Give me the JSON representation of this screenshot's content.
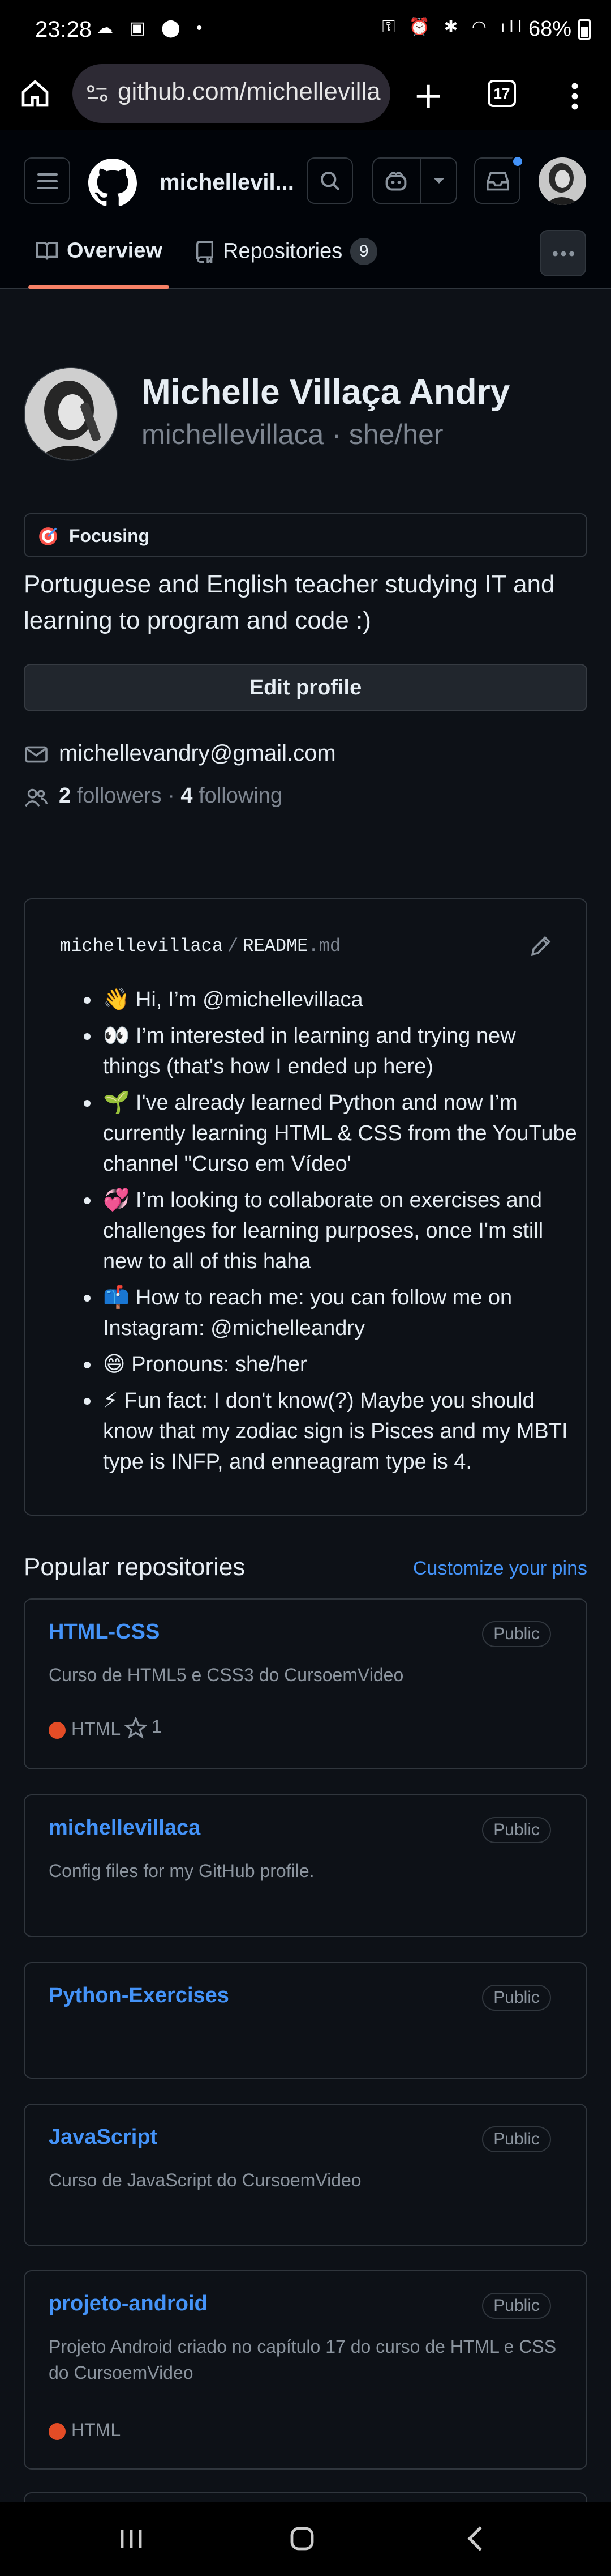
{
  "status_bar": {
    "time": "23:28",
    "battery": "68%"
  },
  "browser": {
    "url": "github.com/michellevilla",
    "tab_count": "17"
  },
  "header": {
    "username": "michellevil...",
    "tabs": [
      {
        "label": "Overview"
      },
      {
        "label": "Repositories",
        "count": "9"
      }
    ]
  },
  "profile": {
    "name": "Michelle Villaça Andry",
    "login": "michellevillaca · she/her",
    "status": "Focusing",
    "bio": "Portuguese and English teacher studying IT and learning to program and code :)",
    "edit_label": "Edit profile",
    "email": "michellevandry@gmail.com",
    "followers_count": "2",
    "followers_label": " followers · ",
    "following_count": "4",
    "following_label": " following"
  },
  "readme": {
    "owner": "michellevillaca",
    "separator": "/",
    "file": "README",
    "ext": ".md",
    "items": [
      "👋 Hi, I’m @michellevillaca",
      "👀 I’m interested in learning and trying new things (that's how I ended up here)",
      "🌱 I've already learned Python and now I’m currently learning HTML & CSS from the YouTube channel \"Curso em Vídeo'",
      "💞️ I’m looking to collaborate on exercises and challenges for learning purposes, once I'm still new to all of this haha",
      "📫 How to reach me: you can follow me on Instagram: @michelleandry",
      "😄 Pronouns: she/her",
      "⚡ Fun fact: I don't know(?) Maybe you should know that my zodiac sign is Pisces and my MBTI type is INFP, and enneagram type is 4."
    ]
  },
  "repos_section": {
    "title": "Popular repositories",
    "customize": "Customize your pins"
  },
  "repos": [
    {
      "name": "HTML-CSS",
      "visibility": "Public",
      "description": "Curso de HTML5 e CSS3 do CursoemVideo",
      "language": "HTML",
      "stars": "1"
    },
    {
      "name": "michellevillaca",
      "visibility": "Public",
      "description": "Config files for my GitHub profile."
    },
    {
      "name": "Python-Exercises",
      "visibility": "Public"
    },
    {
      "name": "JavaScript",
      "visibility": "Public",
      "description": "Curso de JavaScript do CursoemVideo"
    },
    {
      "name": "projeto-android",
      "visibility": "Public",
      "description": "Projeto Android criado no capítulo 17 do curso de HTML e CSS do CursoemVideo",
      "language": "HTML"
    }
  ],
  "colors": {
    "accent": "#4493f8",
    "tab_underline": "#f78166",
    "html_lang": "#e34c26",
    "background": "#0d1117"
  }
}
